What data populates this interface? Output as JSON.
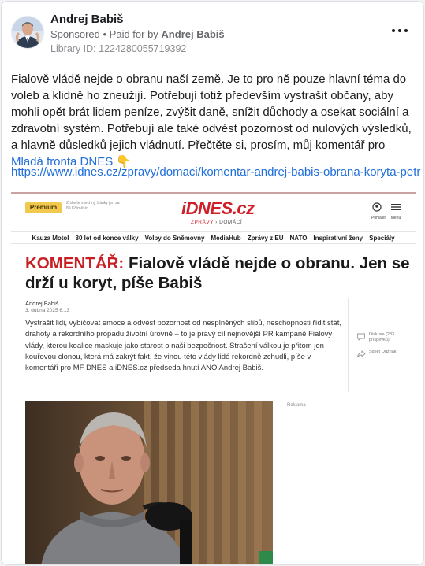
{
  "post": {
    "page_name": "Andrej Babiš",
    "sponsored": "Sponsored",
    "paid_for_prefix": " • Paid for by ",
    "paid_for_by": "Andrej Babiš",
    "library_id": "Library ID: 1224280055719392",
    "text_main": "Fialově vládě nejde o obranu naší země. Je to pro ně pouze hlavní téma do voleb a klidně ho zneužijí. Potřebují totiž především vystrašit občany, aby mohli opět brát lidem peníze, zvýšit daně, snížit důchody a osekat sociální a zdravotní systém. Potřebují ale také odvést pozornost od nulových výsledků, a hlavně důsledků jejich vládnutí. Přečtěte si, prosím, můj komentář pro ",
    "text_link": "Mladá fronta DNES",
    "text_emoji": " 👇",
    "url": "https://www.idnes.cz/zpravy/domaci/komentar-andrej-babis-obrana-koryta-petr-…"
  },
  "article": {
    "premium_label": "Premium",
    "premium_note": "Získejte všechny články jen za 89 Kč/měsíc",
    "logo": "iDNES.cz",
    "section_prefix": "ZPRÁVY",
    "section_sep": " › ",
    "section": "DOMÁCÍ",
    "profile_label": "Přihlásit",
    "menu_label": "Menu",
    "nav_items": [
      "Kauza Motol",
      "80 let od konce války",
      "Volby do Sněmovny",
      "MediaHub",
      "Zprávy z EU",
      "NATO",
      "Inspirativní ženy",
      "Speciály"
    ],
    "title_prefix": "KOMENTÁŘ:",
    "title_rest": " Fialově vládě nejde o obranu. Jen se drží u koryt, píše Babiš",
    "author": "Andrej Babiš",
    "date": "3. dubna 2025  6:13",
    "perex": "Vystrašit lidi, vybičovat emoce a odvést pozornost od nesplněných slibů, neschopnosti řídit stát, drahoty a rekordního propadu životní úrovně – to je pravý cíl nejnovější PR kampaně Fialovy vlády, kterou koalice maskuje jako starost o naši bezpečnost. Strašení válkou je přitom jen kouřovou clonou, která má zakrýt fakt, že vinou této vlády lidé rekordně zchudli, píše v komentáři pro MF DNES a iDNES.cz předseda hnutí ANO Andrej Babiš.",
    "discussion_label": "Diskuse (283 příspěvků)",
    "share_label": "Sdílet Odznak",
    "ad_label": "Reklama"
  },
  "colors": {
    "fb_link": "#216fdb",
    "idnes_red": "#c81e24",
    "premium_yellow": "#f2c94c"
  }
}
